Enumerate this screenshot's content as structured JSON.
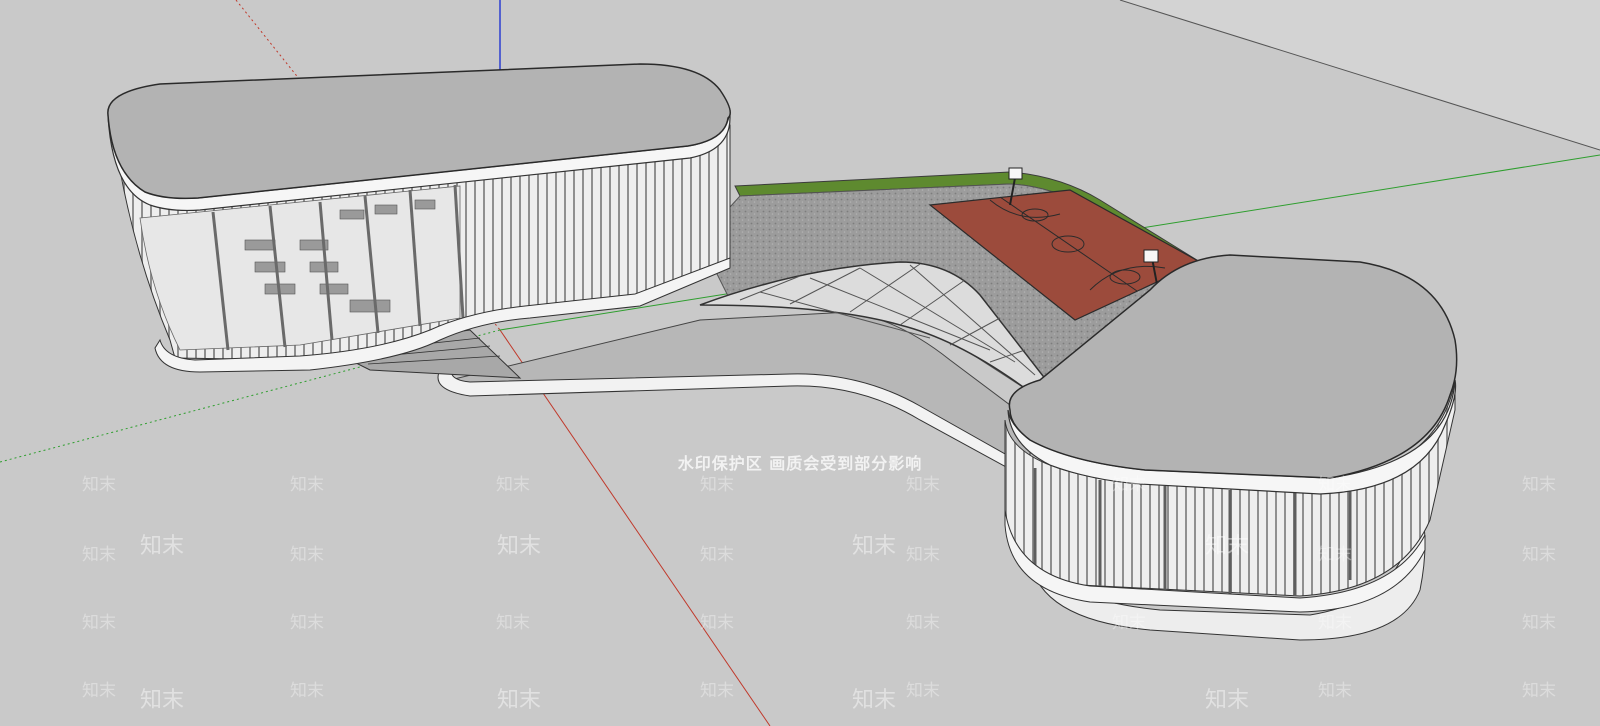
{
  "watermark": {
    "banner_text": "水印保护区  画质会受到部分影响",
    "logo_text": "知末"
  },
  "scene": {
    "background_color": "#c9c9c9",
    "axis_colors": {
      "red": "#c0392b",
      "green": "#2e9e2e",
      "blue": "#2c3fd1"
    },
    "court_color": "#9c4b3c",
    "grass_color": "#5e8a2f"
  }
}
